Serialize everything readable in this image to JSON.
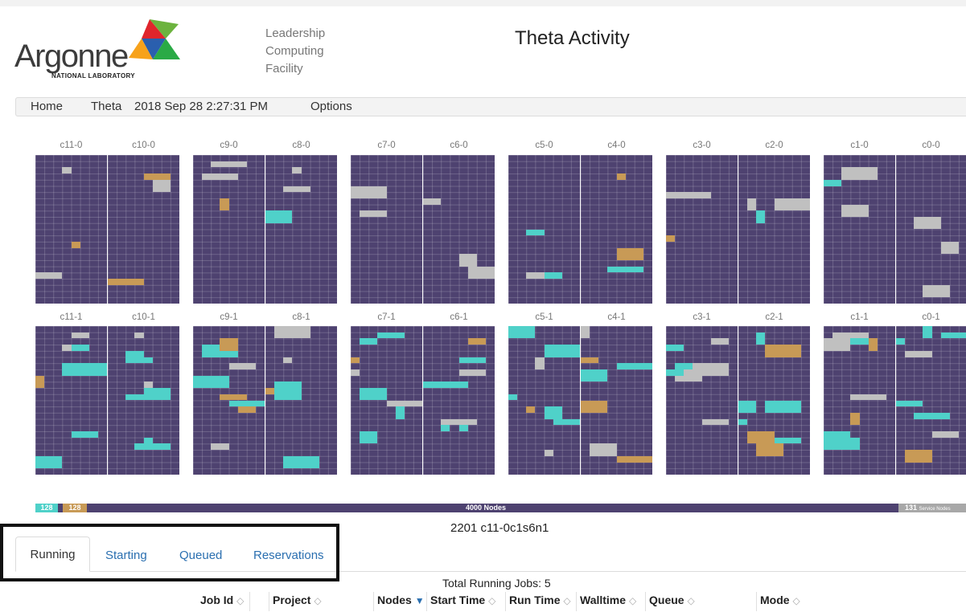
{
  "org": {
    "name": "Argonne",
    "subtitle": "NATIONAL LABORATORY"
  },
  "facility": {
    "line1": "Leadership",
    "line2": "Computing",
    "line3": "Facility"
  },
  "page_title": "Theta Activity",
  "nav": {
    "home": "Home",
    "machine": "Theta",
    "timestamp": "2018 Sep 28 2:27:31 PM",
    "options": "Options"
  },
  "colors": {
    "idle": "#4e4270",
    "running_cyan": "#4fd1c9",
    "running_tan": "#c89a56",
    "service": "#c0c0c0",
    "starting_pink": "#f07ab0",
    "lime": "#c8e06a"
  },
  "cabinets_row0": [
    "c11-0",
    "c10-0",
    "c9-0",
    "c8-0",
    "c7-0",
    "c6-0",
    "c5-0",
    "c4-0",
    "c3-0",
    "c2-0",
    "c1-0",
    "c0-0"
  ],
  "cabinets_row1": [
    "c11-1",
    "c10-1",
    "c9-1",
    "c8-1",
    "c7-1",
    "c6-1",
    "c5-1",
    "c4-1",
    "c3-1",
    "c2-1",
    "c1-1",
    "c0-1"
  ],
  "legend": {
    "cyan_count": "128",
    "tan_count": "128",
    "nodes": "4000 Nodes",
    "service": "131",
    "service_label": "Service Nodes"
  },
  "selected_node": "2201 c11-0c1s6n1",
  "tabs": [
    "Running",
    "Starting",
    "Queued",
    "Reservations"
  ],
  "total_running": "Total Running Jobs: 5",
  "table_headers": [
    "Job Id",
    "Project",
    "Nodes",
    "Start Time",
    "Run Time",
    "Walltime",
    "Queue",
    "Mode"
  ]
}
